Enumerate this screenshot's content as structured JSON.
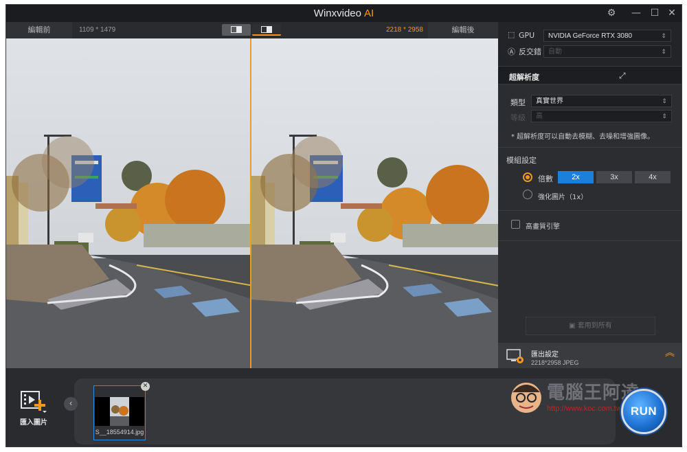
{
  "window": {
    "title": "Winxvideo",
    "title_accent": "AI"
  },
  "compare": {
    "before_label": "編輯前",
    "before_resolution": "1109 * 1479",
    "after_resolution": "2218 * 2958",
    "after_label": "編輯後"
  },
  "sidebar": {
    "gpu_label": "GPU",
    "gpu_value": "NVIDIA GeForce RTX 3080",
    "anti_alias_label": "反交錯",
    "anti_alias_value": "自動",
    "section_title": "超解析度",
    "type_label": "類型",
    "type_value": "真實世界",
    "sub_label": "等級",
    "sub_value": "高",
    "note": "* 超解析度可以自動去模糊、去噪和增強圖像。",
    "model_label": "模組設定",
    "scale_label": "倍數",
    "scale_options": [
      "2x",
      "3x",
      "4x"
    ],
    "scale_selected": "2x",
    "enhance_label": "強化圖片（1x）",
    "hq_label": "高畫質引擎",
    "apply_all": "套用到所有",
    "export_title": "匯出設定",
    "export_info": "2218*2958  JPEG"
  },
  "bottom": {
    "import_label": "匯入圖片",
    "thumb_filename": "S__18554914.jpg",
    "run_label": "RUN"
  },
  "watermark": {
    "text": "電腦王阿達",
    "url": "http://www.koc.com.tw"
  },
  "colors": {
    "accent": "#f39a1e",
    "active_blue": "#1e7fd9"
  }
}
